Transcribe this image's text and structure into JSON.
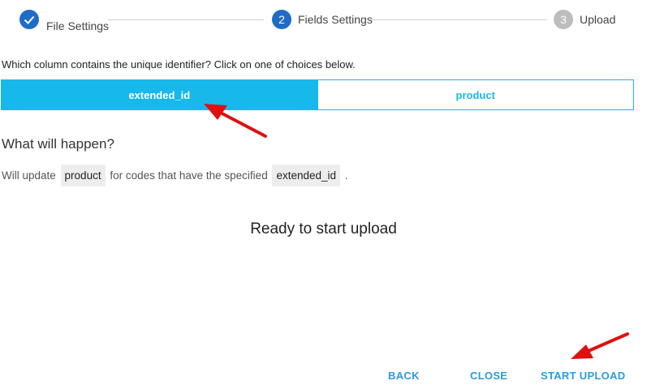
{
  "stepper": {
    "steps": [
      {
        "number": "",
        "label": "File Settings",
        "state": "done"
      },
      {
        "number": "2",
        "label": "Fields Settings",
        "state": "active"
      },
      {
        "number": "3",
        "label": "Upload",
        "state": "pending"
      }
    ],
    "colors": {
      "active": "#1f6cc6",
      "pending": "#bdbdbd"
    }
  },
  "main": {
    "question": "Which column contains the unique identifier? Click on one of choices below.",
    "choices": [
      {
        "label": "extended_id",
        "selected": true
      },
      {
        "label": "product",
        "selected": false
      }
    ],
    "what_title": "What will happen?",
    "desc": {
      "prefix": "Will update ",
      "field": "product",
      "middle": " for codes that have the specified ",
      "identifier": "extended_id",
      "suffix": " ."
    },
    "ready_text": "Ready to start upload"
  },
  "footer": {
    "back_label": "BACK",
    "close_label": "CLOSE",
    "start_label": "START UPLOAD"
  },
  "accent_color": "#17b8ea",
  "annotation_color": "#e01010"
}
